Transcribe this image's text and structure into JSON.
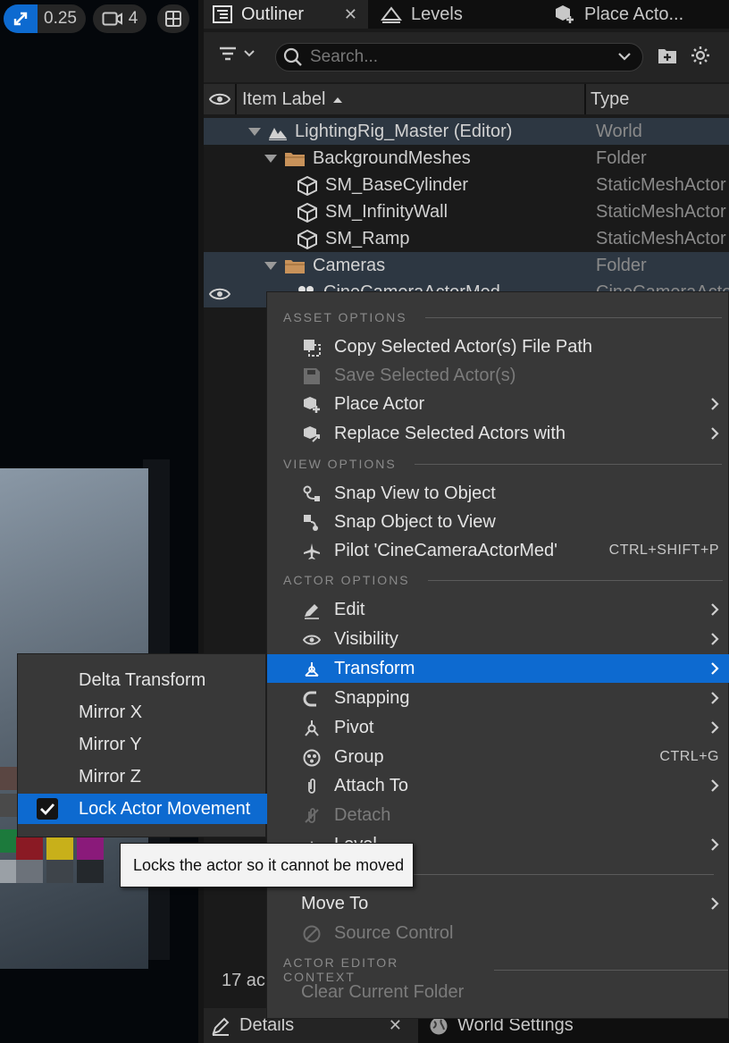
{
  "colors": {
    "accent": "#0d6ad0",
    "menu_bg": "#383838",
    "panel_bg": "#1a1a1a",
    "highlight_row": "#2d3742",
    "folder": "#c8925a"
  },
  "viewport": {
    "scale_value": "0.25",
    "camera_speed": "4"
  },
  "tabs": {
    "outliner": "Outliner",
    "levels": "Levels",
    "place_actors": "Place Acto..."
  },
  "search": {
    "placeholder": "Search..."
  },
  "columns": {
    "label": "Item Label",
    "type": "Type"
  },
  "tree": [
    {
      "label": "LightingRig_Master (Editor)",
      "type": "World",
      "icon": "world-icon"
    },
    {
      "label": "BackgroundMeshes",
      "type": "Folder",
      "icon": "folder-icon"
    },
    {
      "label": "SM_BaseCylinder",
      "type": "StaticMeshActor",
      "icon": "static-mesh-icon"
    },
    {
      "label": "SM_InfinityWall",
      "type": "StaticMeshActor",
      "icon": "static-mesh-icon"
    },
    {
      "label": "SM_Ramp",
      "type": "StaticMeshActor",
      "icon": "static-mesh-icon"
    },
    {
      "label": "Cameras",
      "type": "Folder",
      "icon": "folder-icon"
    },
    {
      "label": "CineCameraActorMed",
      "type": "CineCameraActor",
      "icon": "cine-camera-icon"
    }
  ],
  "footer": {
    "count_text": "17 ac"
  },
  "bottom_tabs": {
    "details": "Details",
    "world_settings": "World Settings"
  },
  "context_menu": {
    "sections": {
      "asset": "ASSET OPTIONS",
      "view": "VIEW OPTIONS",
      "actor": "ACTOR OPTIONS",
      "editor_context": "ACTOR EDITOR CONTEXT"
    },
    "items": {
      "copy_path": "Copy Selected Actor(s) File Path",
      "save_actors": "Save Selected Actor(s)",
      "place_actor": "Place Actor",
      "replace_actors": "Replace Selected Actors with",
      "snap_view": "Snap View to Object",
      "snap_object": "Snap Object to View",
      "pilot": "Pilot 'CineCameraActorMed'",
      "pilot_shortcut": "CTRL+SHIFT+P",
      "edit": "Edit",
      "visibility": "Visibility",
      "transform": "Transform",
      "snapping": "Snapping",
      "pivot": "Pivot",
      "group": "Group",
      "group_shortcut": "CTRL+G",
      "attach_to": "Attach To",
      "detach": "Detach",
      "level": "Level",
      "move_to": "Move To",
      "source_control": "Source Control",
      "clear_folder": "Clear Current Folder"
    }
  },
  "transform_submenu": {
    "delta_transform": "Delta Transform",
    "mirror_x": "Mirror X",
    "mirror_y": "Mirror Y",
    "mirror_z": "Mirror Z",
    "lock_movement": "Lock Actor Movement"
  },
  "tooltip": {
    "text": "Locks the actor so it cannot be moved"
  }
}
